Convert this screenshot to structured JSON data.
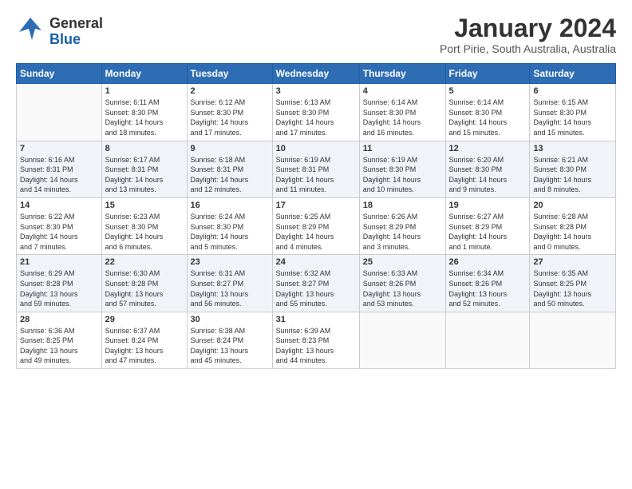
{
  "header": {
    "logo_general": "General",
    "logo_blue": "Blue",
    "title": "January 2024",
    "location": "Port Pirie, South Australia, Australia"
  },
  "days_of_week": [
    "Sunday",
    "Monday",
    "Tuesday",
    "Wednesday",
    "Thursday",
    "Friday",
    "Saturday"
  ],
  "weeks": [
    [
      {
        "day": "",
        "info": ""
      },
      {
        "day": "1",
        "info": "Sunrise: 6:11 AM\nSunset: 8:30 PM\nDaylight: 14 hours\nand 18 minutes."
      },
      {
        "day": "2",
        "info": "Sunrise: 6:12 AM\nSunset: 8:30 PM\nDaylight: 14 hours\nand 17 minutes."
      },
      {
        "day": "3",
        "info": "Sunrise: 6:13 AM\nSunset: 8:30 PM\nDaylight: 14 hours\nand 17 minutes."
      },
      {
        "day": "4",
        "info": "Sunrise: 6:14 AM\nSunset: 8:30 PM\nDaylight: 14 hours\nand 16 minutes."
      },
      {
        "day": "5",
        "info": "Sunrise: 6:14 AM\nSunset: 8:30 PM\nDaylight: 14 hours\nand 15 minutes."
      },
      {
        "day": "6",
        "info": "Sunrise: 6:15 AM\nSunset: 8:30 PM\nDaylight: 14 hours\nand 15 minutes."
      }
    ],
    [
      {
        "day": "7",
        "info": "Sunrise: 6:16 AM\nSunset: 8:31 PM\nDaylight: 14 hours\nand 14 minutes."
      },
      {
        "day": "8",
        "info": "Sunrise: 6:17 AM\nSunset: 8:31 PM\nDaylight: 14 hours\nand 13 minutes."
      },
      {
        "day": "9",
        "info": "Sunrise: 6:18 AM\nSunset: 8:31 PM\nDaylight: 14 hours\nand 12 minutes."
      },
      {
        "day": "10",
        "info": "Sunrise: 6:19 AM\nSunset: 8:31 PM\nDaylight: 14 hours\nand 11 minutes."
      },
      {
        "day": "11",
        "info": "Sunrise: 6:19 AM\nSunset: 8:30 PM\nDaylight: 14 hours\nand 10 minutes."
      },
      {
        "day": "12",
        "info": "Sunrise: 6:20 AM\nSunset: 8:30 PM\nDaylight: 14 hours\nand 9 minutes."
      },
      {
        "day": "13",
        "info": "Sunrise: 6:21 AM\nSunset: 8:30 PM\nDaylight: 14 hours\nand 8 minutes."
      }
    ],
    [
      {
        "day": "14",
        "info": "Sunrise: 6:22 AM\nSunset: 8:30 PM\nDaylight: 14 hours\nand 7 minutes."
      },
      {
        "day": "15",
        "info": "Sunrise: 6:23 AM\nSunset: 8:30 PM\nDaylight: 14 hours\nand 6 minutes."
      },
      {
        "day": "16",
        "info": "Sunrise: 6:24 AM\nSunset: 8:30 PM\nDaylight: 14 hours\nand 5 minutes."
      },
      {
        "day": "17",
        "info": "Sunrise: 6:25 AM\nSunset: 8:29 PM\nDaylight: 14 hours\nand 4 minutes."
      },
      {
        "day": "18",
        "info": "Sunrise: 6:26 AM\nSunset: 8:29 PM\nDaylight: 14 hours\nand 3 minutes."
      },
      {
        "day": "19",
        "info": "Sunrise: 6:27 AM\nSunset: 8:29 PM\nDaylight: 14 hours\nand 1 minute."
      },
      {
        "day": "20",
        "info": "Sunrise: 6:28 AM\nSunset: 8:28 PM\nDaylight: 14 hours\nand 0 minutes."
      }
    ],
    [
      {
        "day": "21",
        "info": "Sunrise: 6:29 AM\nSunset: 8:28 PM\nDaylight: 13 hours\nand 59 minutes."
      },
      {
        "day": "22",
        "info": "Sunrise: 6:30 AM\nSunset: 8:28 PM\nDaylight: 13 hours\nand 57 minutes."
      },
      {
        "day": "23",
        "info": "Sunrise: 6:31 AM\nSunset: 8:27 PM\nDaylight: 13 hours\nand 56 minutes."
      },
      {
        "day": "24",
        "info": "Sunrise: 6:32 AM\nSunset: 8:27 PM\nDaylight: 13 hours\nand 55 minutes."
      },
      {
        "day": "25",
        "info": "Sunrise: 6:33 AM\nSunset: 8:26 PM\nDaylight: 13 hours\nand 53 minutes."
      },
      {
        "day": "26",
        "info": "Sunrise: 6:34 AM\nSunset: 8:26 PM\nDaylight: 13 hours\nand 52 minutes."
      },
      {
        "day": "27",
        "info": "Sunrise: 6:35 AM\nSunset: 8:25 PM\nDaylight: 13 hours\nand 50 minutes."
      }
    ],
    [
      {
        "day": "28",
        "info": "Sunrise: 6:36 AM\nSunset: 8:25 PM\nDaylight: 13 hours\nand 49 minutes."
      },
      {
        "day": "29",
        "info": "Sunrise: 6:37 AM\nSunset: 8:24 PM\nDaylight: 13 hours\nand 47 minutes."
      },
      {
        "day": "30",
        "info": "Sunrise: 6:38 AM\nSunset: 8:24 PM\nDaylight: 13 hours\nand 45 minutes."
      },
      {
        "day": "31",
        "info": "Sunrise: 6:39 AM\nSunset: 8:23 PM\nDaylight: 13 hours\nand 44 minutes."
      },
      {
        "day": "",
        "info": ""
      },
      {
        "day": "",
        "info": ""
      },
      {
        "day": "",
        "info": ""
      }
    ]
  ]
}
